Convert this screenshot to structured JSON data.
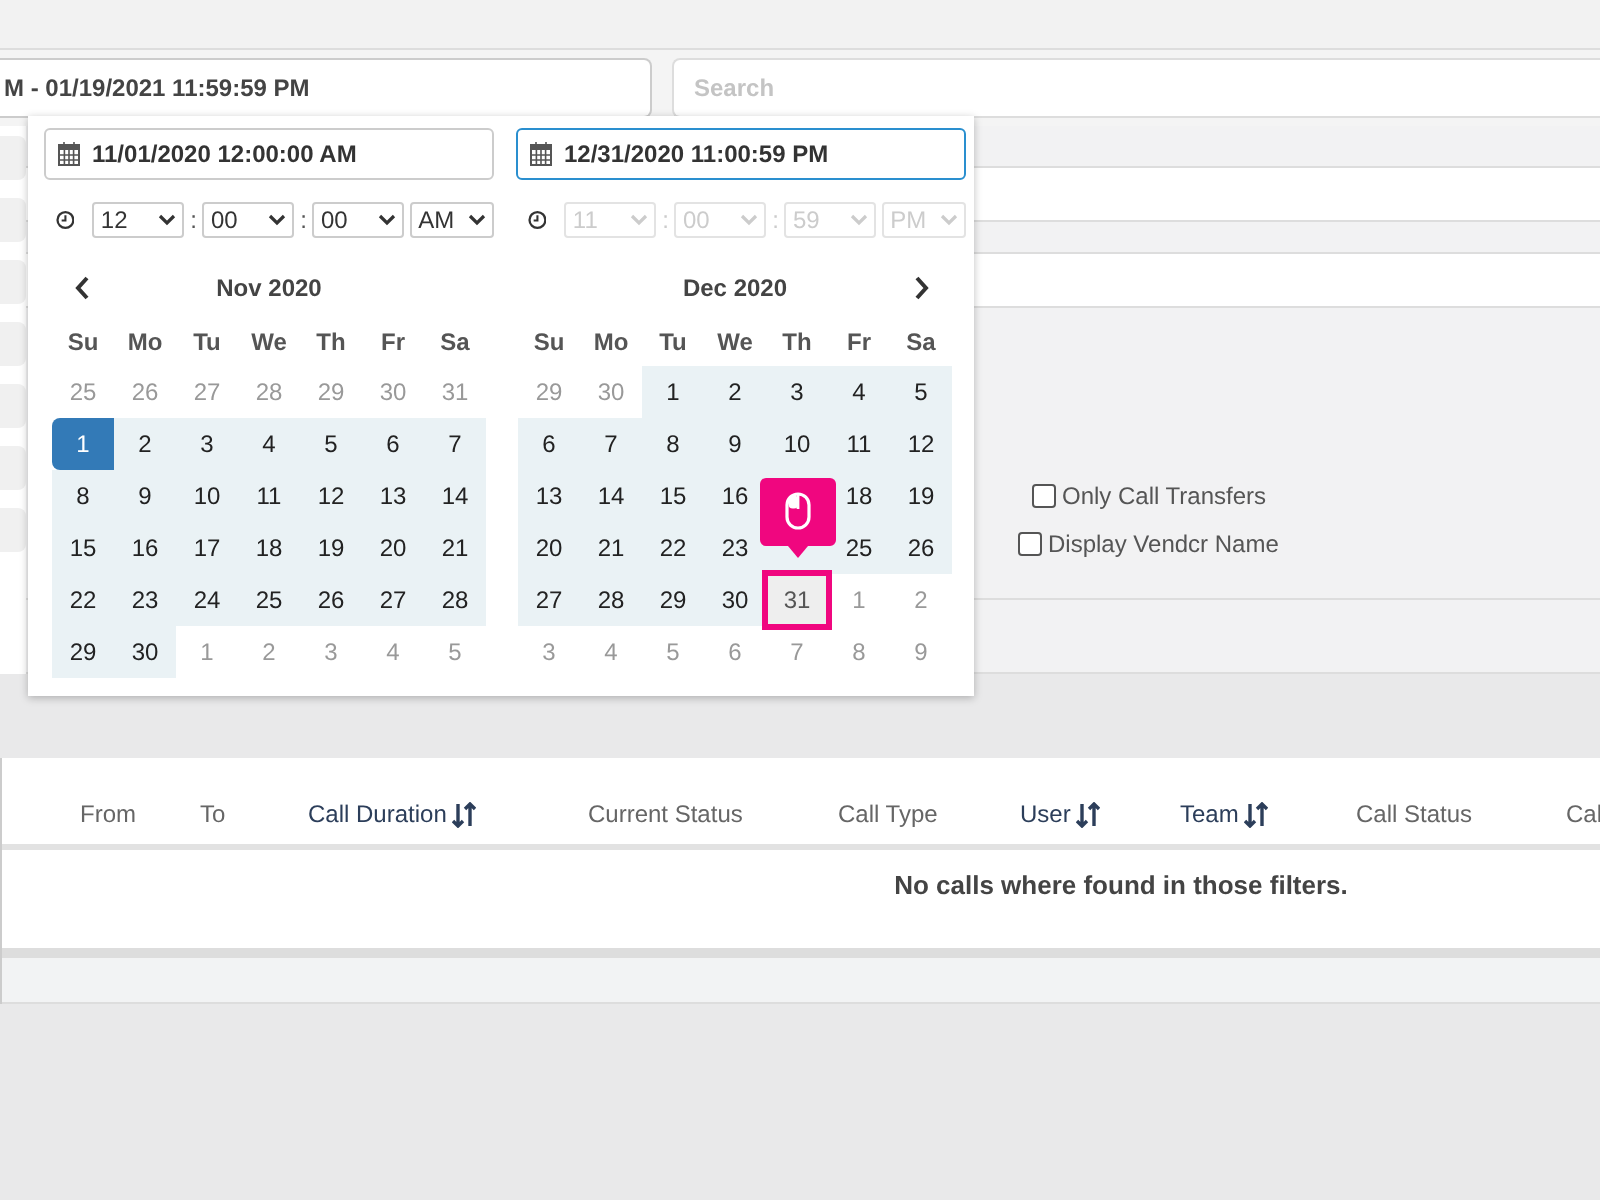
{
  "filters": {
    "date_range": "M - 01/19/2021 11:59:59 PM",
    "search": {
      "placeholder": "Search"
    }
  },
  "picker": {
    "inputs": [
      {
        "value": "11/01/2020 12:00:00 AM",
        "focused": false,
        "disabled": false,
        "time": [
          "12",
          "00",
          "00",
          "AM"
        ],
        "separators": [
          ":",
          ":"
        ]
      },
      {
        "value": "12/31/2020 11:00:59 PM",
        "focused": true,
        "disabled": true,
        "time": [
          "11",
          "00",
          "59",
          "PM"
        ],
        "separators": [
          ":",
          ":"
        ]
      }
    ],
    "months": [
      {
        "title": "Nov 2020",
        "weekdays": [
          "Su",
          "Mo",
          "Tu",
          "We",
          "Th",
          "Fr",
          "Sa"
        ],
        "days": [
          {
            "d": "25",
            "kind": "muted"
          },
          {
            "d": "26",
            "kind": "muted"
          },
          {
            "d": "27",
            "kind": "muted"
          },
          {
            "d": "28",
            "kind": "muted"
          },
          {
            "d": "29",
            "kind": "muted"
          },
          {
            "d": "30",
            "kind": "muted"
          },
          {
            "d": "31",
            "kind": "muted"
          },
          {
            "d": "1",
            "kind": "start"
          },
          {
            "d": "2",
            "kind": "range"
          },
          {
            "d": "3",
            "kind": "range"
          },
          {
            "d": "4",
            "kind": "range"
          },
          {
            "d": "5",
            "kind": "range"
          },
          {
            "d": "6",
            "kind": "range"
          },
          {
            "d": "7",
            "kind": "range"
          },
          {
            "d": "8",
            "kind": "range"
          },
          {
            "d": "9",
            "kind": "range"
          },
          {
            "d": "10",
            "kind": "range"
          },
          {
            "d": "11",
            "kind": "range"
          },
          {
            "d": "12",
            "kind": "range"
          },
          {
            "d": "13",
            "kind": "range"
          },
          {
            "d": "14",
            "kind": "range"
          },
          {
            "d": "15",
            "kind": "range"
          },
          {
            "d": "16",
            "kind": "range"
          },
          {
            "d": "17",
            "kind": "range"
          },
          {
            "d": "18",
            "kind": "range"
          },
          {
            "d": "19",
            "kind": "range"
          },
          {
            "d": "20",
            "kind": "range"
          },
          {
            "d": "21",
            "kind": "range"
          },
          {
            "d": "22",
            "kind": "range"
          },
          {
            "d": "23",
            "kind": "range"
          },
          {
            "d": "24",
            "kind": "range"
          },
          {
            "d": "25",
            "kind": "range"
          },
          {
            "d": "26",
            "kind": "range"
          },
          {
            "d": "27",
            "kind": "range"
          },
          {
            "d": "28",
            "kind": "range"
          },
          {
            "d": "29",
            "kind": "range"
          },
          {
            "d": "30",
            "kind": "range"
          },
          {
            "d": "1",
            "kind": "muted"
          },
          {
            "d": "2",
            "kind": "muted"
          },
          {
            "d": "3",
            "kind": "muted"
          },
          {
            "d": "4",
            "kind": "muted"
          },
          {
            "d": "5",
            "kind": "muted"
          }
        ]
      },
      {
        "title": "Dec 2020",
        "weekdays": [
          "Su",
          "Mo",
          "Tu",
          "We",
          "Th",
          "Fr",
          "Sa"
        ],
        "days": [
          {
            "d": "29",
            "kind": "muted"
          },
          {
            "d": "30",
            "kind": "muted"
          },
          {
            "d": "1",
            "kind": "range"
          },
          {
            "d": "2",
            "kind": "range"
          },
          {
            "d": "3",
            "kind": "range"
          },
          {
            "d": "4",
            "kind": "range"
          },
          {
            "d": "5",
            "kind": "range"
          },
          {
            "d": "6",
            "kind": "range"
          },
          {
            "d": "7",
            "kind": "range"
          },
          {
            "d": "8",
            "kind": "range"
          },
          {
            "d": "9",
            "kind": "range"
          },
          {
            "d": "10",
            "kind": "range"
          },
          {
            "d": "11",
            "kind": "range"
          },
          {
            "d": "12",
            "kind": "range"
          },
          {
            "d": "13",
            "kind": "range"
          },
          {
            "d": "14",
            "kind": "range"
          },
          {
            "d": "15",
            "kind": "range"
          },
          {
            "d": "16",
            "kind": "range"
          },
          {
            "kind": "covered"
          },
          {
            "d": "18",
            "kind": "range"
          },
          {
            "d": "19",
            "kind": "range"
          },
          {
            "d": "20",
            "kind": "range"
          },
          {
            "d": "21",
            "kind": "range"
          },
          {
            "d": "22",
            "kind": "range"
          },
          {
            "d": "23",
            "kind": "range"
          },
          {
            "kind": "covered"
          },
          {
            "d": "25",
            "kind": "range"
          },
          {
            "d": "26",
            "kind": "range"
          },
          {
            "d": "27",
            "kind": "range"
          },
          {
            "d": "28",
            "kind": "range"
          },
          {
            "d": "29",
            "kind": "range"
          },
          {
            "d": "30",
            "kind": "range"
          },
          {
            "d": "31",
            "kind": "hover"
          },
          {
            "d": "1",
            "kind": "muted"
          },
          {
            "d": "2",
            "kind": "muted"
          },
          {
            "d": "3",
            "kind": "muted"
          },
          {
            "d": "4",
            "kind": "muted"
          },
          {
            "d": "5",
            "kind": "muted"
          },
          {
            "d": "6",
            "kind": "muted"
          },
          {
            "d": "7",
            "kind": "muted"
          },
          {
            "d": "8",
            "kind": "muted"
          },
          {
            "d": "9",
            "kind": "muted"
          }
        ]
      }
    ]
  },
  "options": [
    {
      "label": "Only Call Transfers",
      "checked": false
    },
    {
      "label": "Display Vendcr Name",
      "checked": false
    }
  ],
  "table": {
    "columns": [
      {
        "label": "From",
        "sortable": false
      },
      {
        "label": "To",
        "sortable": false
      },
      {
        "label": "Call Duration",
        "sortable": true
      },
      {
        "label": "Current Status",
        "sortable": false
      },
      {
        "label": "Call Type",
        "sortable": false
      },
      {
        "label": "User",
        "sortable": true
      },
      {
        "label": "Team",
        "sortable": true
      },
      {
        "label": "Call Status",
        "sortable": false
      },
      {
        "label": "Cal",
        "sortable": false
      }
    ],
    "empty_message": "No calls where found in those filters."
  }
}
